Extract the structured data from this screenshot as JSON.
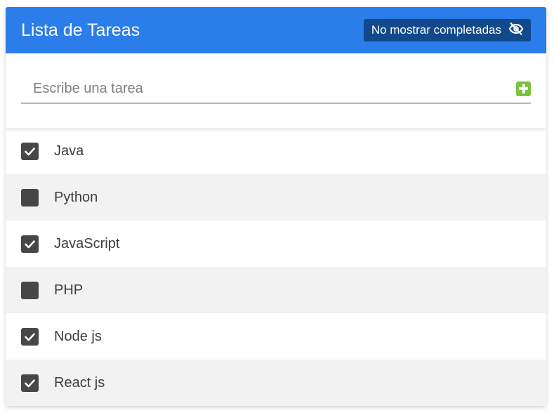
{
  "header": {
    "title": "Lista de Tareas",
    "toggle_label": "No mostrar completadas",
    "toggle_icon": "eye-slash-icon"
  },
  "form": {
    "placeholder": "Escribe una tarea",
    "value": "",
    "add_icon": "plus-square-icon"
  },
  "tasks": [
    {
      "label": "Java",
      "completed": true
    },
    {
      "label": "Python",
      "completed": false
    },
    {
      "label": "JavaScript",
      "completed": true
    },
    {
      "label": "PHP",
      "completed": false
    },
    {
      "label": "Node js",
      "completed": true
    },
    {
      "label": "React js",
      "completed": true
    }
  ],
  "colors": {
    "header_bg": "#2b7de9",
    "toggle_bg": "#11498a",
    "add_green": "#7cc242",
    "checkbox": "#474747",
    "stripe": "#f2f2f2"
  }
}
